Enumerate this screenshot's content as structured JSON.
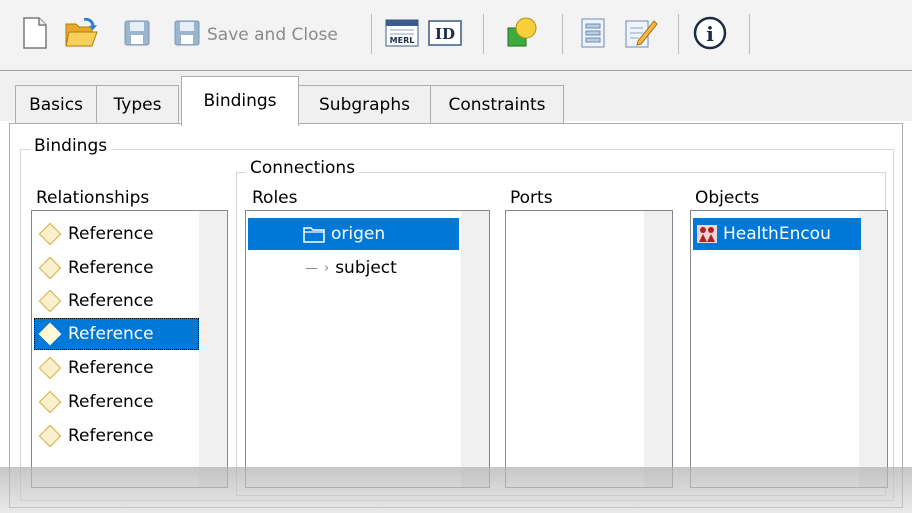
{
  "toolbar": {
    "save_and_close_label": "Save and Close",
    "merl_icon_text": "MERL",
    "id_icon_text": "ID",
    "info_icon_text": "i"
  },
  "tabs": [
    {
      "label": "Basics",
      "active": false
    },
    {
      "label": "Types",
      "active": false
    },
    {
      "label": "Bindings",
      "active": true
    },
    {
      "label": "Subgraphs",
      "active": false
    },
    {
      "label": "Constraints",
      "active": false
    }
  ],
  "bindings": {
    "group_label": "Bindings",
    "relationships_header": "Relationships",
    "relationships": [
      {
        "label": "Reference"
      },
      {
        "label": "Reference"
      },
      {
        "label": "Reference"
      },
      {
        "label": "Reference",
        "selected": true
      },
      {
        "label": "Reference"
      },
      {
        "label": "Reference"
      },
      {
        "label": "Reference"
      }
    ],
    "connections": {
      "group_label": "Connections",
      "roles_header": "Roles",
      "roles": [
        {
          "label": "origen",
          "selected": true
        },
        {
          "label": "subject"
        }
      ],
      "ports_header": "Ports",
      "ports": [],
      "objects_header": "Objects",
      "objects": [
        {
          "label": "HealthEncou",
          "selected": true
        }
      ]
    }
  },
  "colors": {
    "selection": "#0078d7",
    "disabled_text": "#8a8a8a"
  }
}
